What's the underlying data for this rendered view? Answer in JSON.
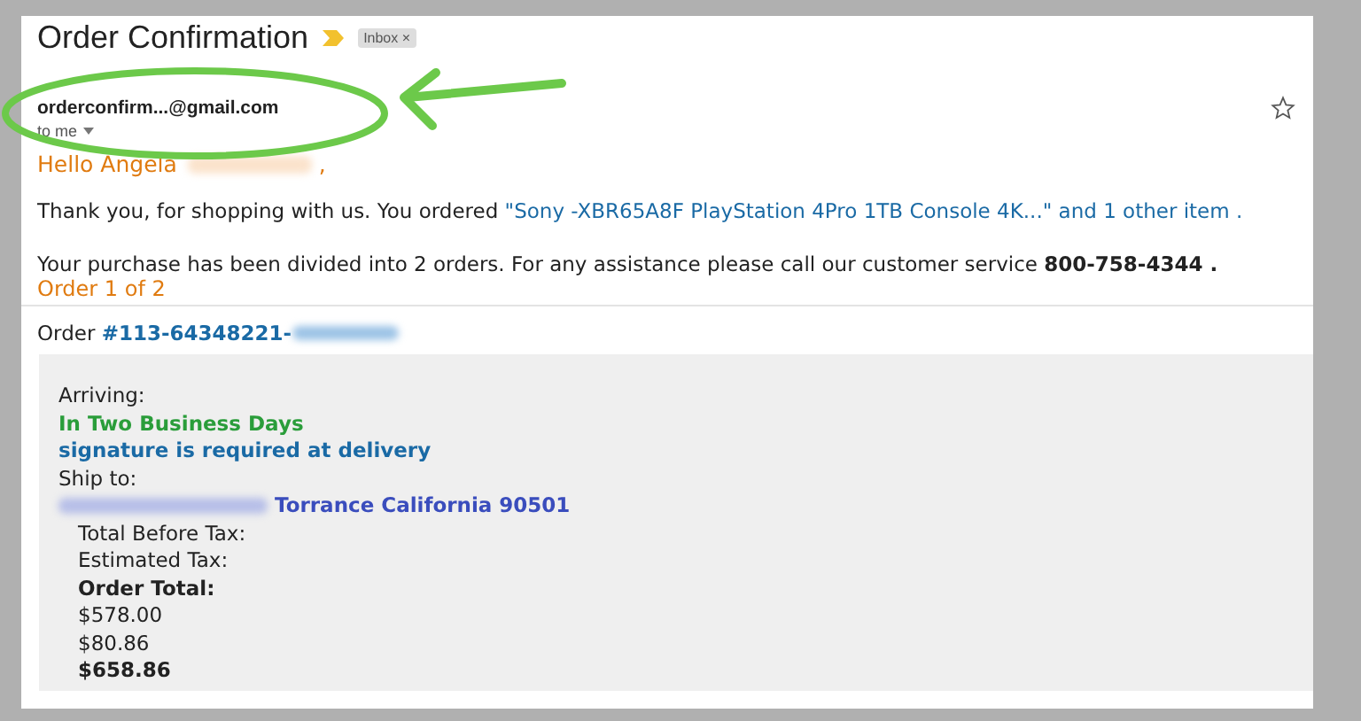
{
  "email": {
    "subject": "Order Confirmation",
    "label": "Inbox",
    "label_close": "×",
    "sender": "orderconfirm...@gmail.com",
    "recipient": "to me",
    "starred": false
  },
  "body": {
    "greeting": "Hello Angela",
    "greeting_end": ",",
    "intro": "Thank you, for shopping with us. You ordered ",
    "product_link": "\"Sony -XBR65A8F PlayStation 4Pro 1TB Console 4K...\" and 1 other item .",
    "split_note": "Your purchase has been divided into 2 orders. For any assistance please call our customer service **800-758-4344 .**",
    "order_heading": "Order 1 of 2",
    "order_label": "Order",
    "order_number": "#113-64348221-",
    "arriving_label": "Arriving:",
    "arrival": "In Two Business Days",
    "signature_note": "signature is required at delivery",
    "ship_label": "Ship to:",
    "address": "Torrance California 90501",
    "totals": [
      {
        "label": "Total Before Tax:",
        "bold": false
      },
      {
        "label": "Estimated Tax:",
        "bold": false
      },
      {
        "label": "Order Total:",
        "bold": true
      }
    ],
    "amounts": [
      {
        "value": "$578.00",
        "bold": false
      },
      {
        "value": "$80.86",
        "bold": false
      },
      {
        "value": "$658.86",
        "bold": true
      }
    ]
  }
}
